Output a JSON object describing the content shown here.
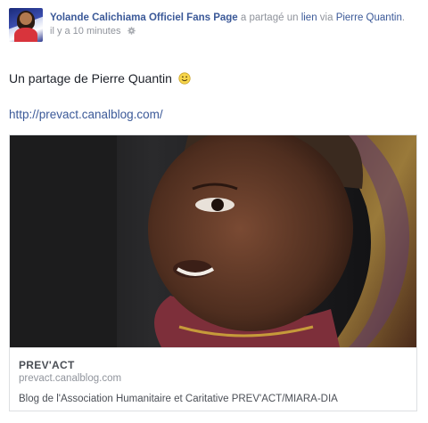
{
  "post": {
    "page_name": "Yolande Calichiama Officiel Fans Page",
    "action_text": " a partagé un ",
    "link_word": "lien",
    "via_text": " via ",
    "via_name": "Pierre Quantin",
    "period": ".",
    "timestamp": "il y a 10 minutes",
    "message": "Un partage de Pierre Quantin",
    "url": "http://prevact.canalblog.com/"
  },
  "card": {
    "title": "PREV'ACT",
    "domain": "prevact.canalblog.com",
    "description": "Blog de l'Association Humanitaire et Caritative PREV'ACT/MIARA-DIA"
  },
  "icons": {
    "audience": "gear-icon",
    "emoji": "smiley-icon"
  },
  "colors": {
    "link": "#3b5998",
    "muted": "#90949c",
    "text": "#1d2129"
  }
}
